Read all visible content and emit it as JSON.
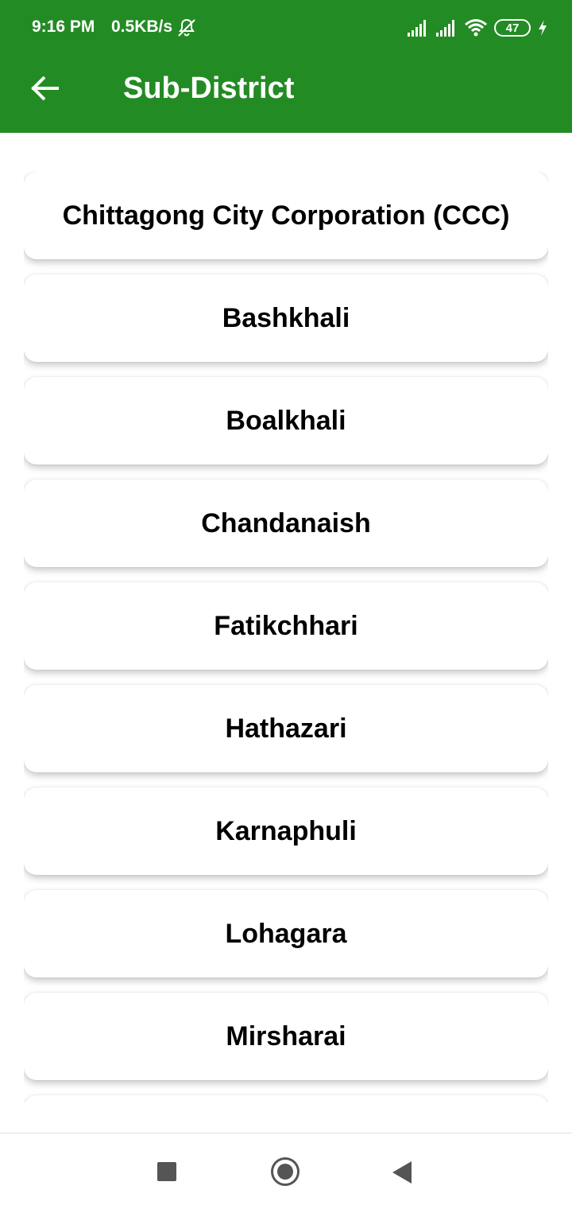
{
  "status_bar": {
    "time": "9:16 PM",
    "net_speed": "0.5KB/s",
    "battery_level": "47",
    "icons": [
      "mute-notifications-icon",
      "signal-icon",
      "signal-icon",
      "wifi-icon",
      "battery-icon",
      "charging-icon"
    ]
  },
  "app_bar": {
    "title": "Sub-District",
    "back_icon": "arrow-left-icon",
    "background_color": "#238b24"
  },
  "sub_districts": [
    "Chittagong City Corporation (CCC)",
    "Bashkhali",
    "Boalkhali",
    "Chandanaish",
    "Fatikchhari",
    "Hathazari",
    "Karnaphuli",
    "Lohagara",
    "Mirsharai"
  ],
  "nav_bar": {
    "icons": [
      "recents-square-icon",
      "home-circle-icon",
      "back-triangle-icon"
    ]
  }
}
